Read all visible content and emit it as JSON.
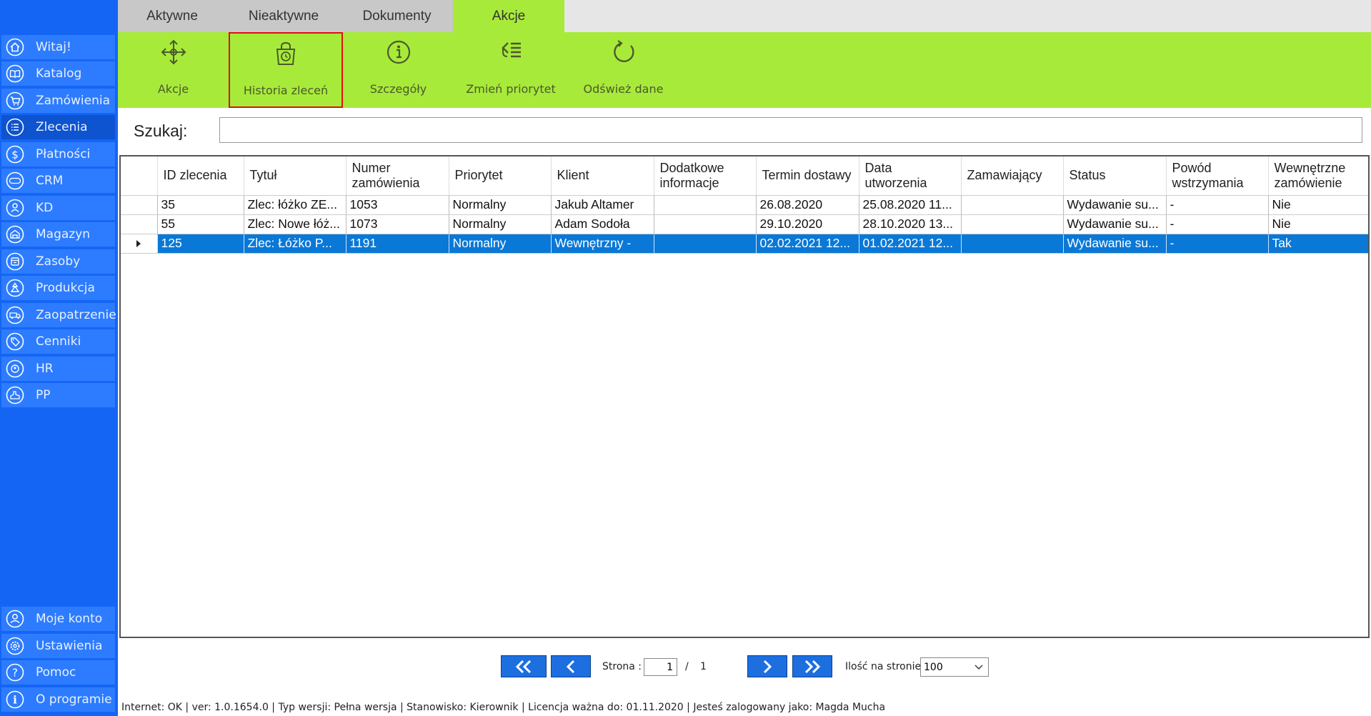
{
  "sidebar": {
    "items": [
      {
        "label": "Witaj!",
        "icon": "home-icon"
      },
      {
        "label": "Katalog",
        "icon": "book-icon"
      },
      {
        "label": "Zamówienia",
        "icon": "cart-icon"
      },
      {
        "label": "Zlecenia",
        "icon": "list-icon"
      },
      {
        "label": "Płatności",
        "icon": "dollar-icon"
      },
      {
        "label": "CRM",
        "icon": "crm-icon"
      },
      {
        "label": "KD",
        "icon": "person-icon"
      },
      {
        "label": "Magazyn",
        "icon": "warehouse-icon"
      },
      {
        "label": "Zasoby",
        "icon": "box-icon"
      },
      {
        "label": "Produkcja",
        "icon": "factory-icon"
      },
      {
        "label": "Zaopatrzenie",
        "icon": "truck-icon"
      },
      {
        "label": "Cenniki",
        "icon": "tag-icon"
      },
      {
        "label": "HR",
        "icon": "hr-icon"
      },
      {
        "label": "PP",
        "icon": "pp-icon"
      }
    ],
    "bottom": [
      {
        "label": "Moje konto",
        "icon": "user-icon"
      },
      {
        "label": "Ustawienia",
        "icon": "gear-icon"
      },
      {
        "label": "Pomoc",
        "icon": "help-icon"
      },
      {
        "label": "O programie",
        "icon": "info-icon"
      }
    ],
    "active": "Zlecenia"
  },
  "tabs": [
    {
      "label": "Aktywne"
    },
    {
      "label": "Nieaktywne"
    },
    {
      "label": "Dokumenty"
    },
    {
      "label": "Akcje"
    }
  ],
  "active_tab": "Akcje",
  "ribbon": {
    "buttons": [
      {
        "label": "Akcje",
        "icon": "move-arrows-icon"
      },
      {
        "label": "Historia zleceń",
        "icon": "bag-history-icon"
      },
      {
        "label": "Szczegóły",
        "icon": "info-circle-icon"
      },
      {
        "label": "Zmień priorytet",
        "icon": "priority-list-icon"
      },
      {
        "label": "Odśwież dane",
        "icon": "refresh-icon"
      }
    ],
    "highlighted": "Historia zleceń"
  },
  "search": {
    "label": "Szukaj:",
    "value": ""
  },
  "grid": {
    "columns": [
      "ID zlecenia",
      "Tytuł",
      "Numer zamówienia",
      "Priorytet",
      "Klient",
      "Dodatkowe informacje",
      "Termin dostawy",
      "Data utworzenia",
      "Zamawiający",
      "Status",
      "Powód wstrzymania",
      "Wewnętrzne zamówienie"
    ],
    "rows": [
      [
        "35",
        "Zlec: łóżko ZE...",
        "1053",
        "Normalny",
        "Jakub  Altamer",
        "",
        "26.08.2020",
        "25.08.2020 11...",
        "",
        "Wydawanie su...",
        "-",
        "Nie"
      ],
      [
        "55",
        "Zlec: Nowe łóż...",
        "1073",
        "Normalny",
        "Adam Sodoła",
        "",
        "29.10.2020",
        "28.10.2020 13...",
        "",
        "Wydawanie su...",
        "-",
        "Nie"
      ],
      [
        "125",
        "Zlec: Łóżko P...",
        "1191",
        "Normalny",
        "Wewnętrzny -",
        "",
        "02.02.2021 12...",
        "01.02.2021 12...",
        "",
        "Wydawanie su...",
        "-",
        "Tak"
      ]
    ],
    "selected_row": 2
  },
  "pagination": {
    "page_label": "Strona :",
    "current_page": "1",
    "separator": "/",
    "total_pages": "1",
    "per_page_label": "Ilość na stronie:",
    "per_page": "100"
  },
  "statusbar": {
    "text": "Internet: OK  |   ver: 1.0.1654.0   |   Typ wersji: Pełna wersja   |   Stanowisko: Kierownik   |   Licencja ważna do: 01.11.2020   |   Jesteś zalogowany jako: Magda Mucha"
  },
  "colors": {
    "sidebar": "#1565f5",
    "sidebar_item": "#2d7cff",
    "ribbon": "#a8ea3a",
    "selected_row": "#0a78d7",
    "highlight_border": "#e01010"
  }
}
